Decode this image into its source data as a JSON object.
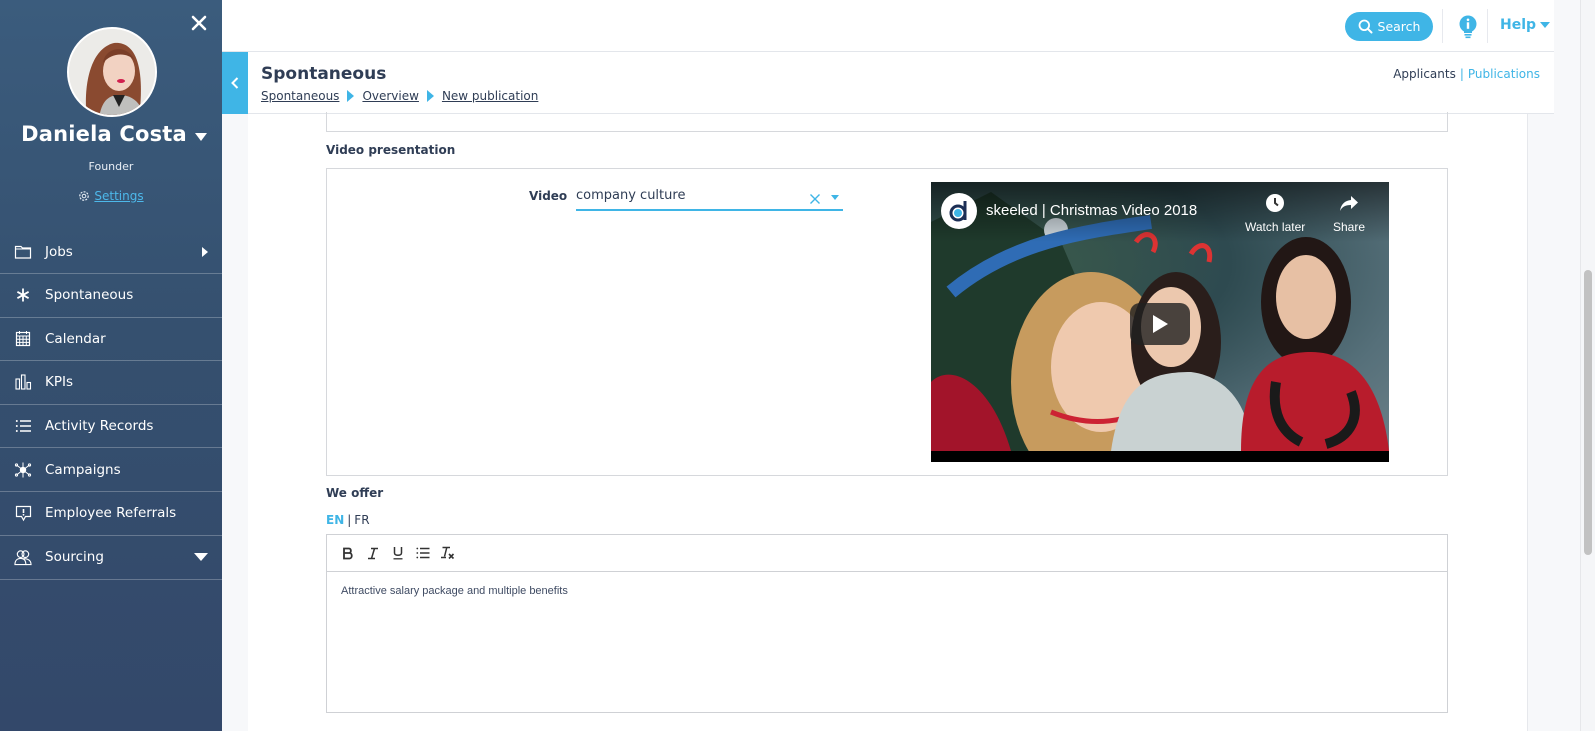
{
  "sidebar": {
    "user": {
      "name": "Daniela Costa",
      "role": "Founder",
      "settings_label": "Settings"
    },
    "items": [
      {
        "label": "Jobs",
        "icon": "folder-icon",
        "indicator": "arrow-right"
      },
      {
        "label": "Spontaneous",
        "icon": "asterisk-icon",
        "indicator": ""
      },
      {
        "label": "Calendar",
        "icon": "calendar-icon",
        "indicator": ""
      },
      {
        "label": "KPIs",
        "icon": "bar-chart-icon",
        "indicator": ""
      },
      {
        "label": "Activity Records",
        "icon": "list-icon",
        "indicator": ""
      },
      {
        "label": "Campaigns",
        "icon": "network-icon",
        "indicator": ""
      },
      {
        "label": "Employee Referrals",
        "icon": "referral-icon",
        "indicator": ""
      },
      {
        "label": "Sourcing",
        "icon": "users-icon",
        "indicator": "arrow-down"
      }
    ]
  },
  "topbar": {
    "search_label": "Search",
    "help_label": "Help"
  },
  "page_header": {
    "title": "Spontaneous",
    "breadcrumb": [
      "Spontaneous",
      "Overview",
      "New publication"
    ],
    "links": {
      "applicants": "Applicants",
      "publications": "Publications",
      "active": "Publications"
    }
  },
  "video_section": {
    "title": "Video presentation",
    "field_label": "Video",
    "selected_value": "company culture",
    "player": {
      "title": "skeeled | Christmas Video 2018",
      "watch_later_label": "Watch later",
      "share_label": "Share"
    }
  },
  "offer_section": {
    "title": "We offer",
    "languages": [
      "EN",
      "FR"
    ],
    "active_language": "EN",
    "toolbar": [
      "bold",
      "italic",
      "underline",
      "bullet-list",
      "clear-format"
    ],
    "content": "Attractive salary package and multiple benefits"
  },
  "colors": {
    "accent": "#3fb5e6",
    "sidebar_bg": "#35506f",
    "text": "#2f3d55"
  }
}
